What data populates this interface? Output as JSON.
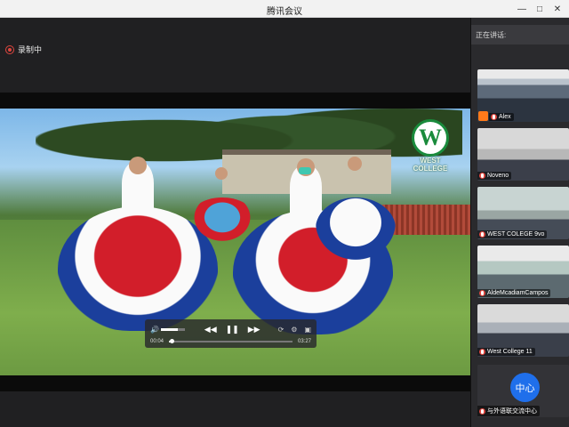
{
  "window": {
    "title": "腾讯会议",
    "controls": [
      "—",
      "□",
      "✕"
    ]
  },
  "recording": {
    "label": "录制中"
  },
  "player": {
    "elapsed": "00:04",
    "duration": "03:27",
    "progress": 0.02,
    "volume": 0.7
  },
  "video": {
    "logo_line1": "WEST",
    "logo_line2": "COLLEGE"
  },
  "sidebar": {
    "speaking_label": "正在讲话:",
    "participants": [
      {
        "name": "Alex",
        "feed": "classroom"
      },
      {
        "name": "Noveno",
        "feed": "room"
      },
      {
        "name": "WEST COLEGE 9vo",
        "feed": "room2"
      },
      {
        "name": "AldeMcadiamCampos",
        "feed": "class3"
      },
      {
        "name": "West College 11",
        "feed": "class4"
      },
      {
        "name": "与外语联交流中心",
        "feed": "avatar",
        "avatar_text": "中心"
      }
    ]
  },
  "colors": {
    "accent": "#1f6feb",
    "record": "#e0463e",
    "brand_green": "#1a8b3c"
  }
}
